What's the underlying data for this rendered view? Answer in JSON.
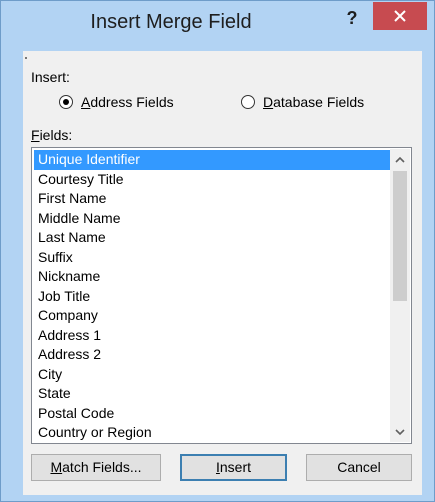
{
  "window": {
    "title": "Insert Merge Field",
    "help_label": "?",
    "close_label": "×"
  },
  "insert": {
    "label": "Insert:",
    "options": [
      {
        "label_mnemonic": "A",
        "label_rest": "ddress Fields",
        "checked": true
      },
      {
        "label_mnemonic": "D",
        "label_rest": "atabase Fields",
        "checked": false
      }
    ]
  },
  "fields": {
    "label_mnemonic": "F",
    "label_rest": "ields:",
    "selected_index": 0,
    "items": [
      "Unique Identifier",
      "Courtesy Title",
      "First Name",
      "Middle Name",
      "Last Name",
      "Suffix",
      "Nickname",
      "Job Title",
      "Company",
      "Address 1",
      "Address 2",
      "City",
      "State",
      "Postal Code",
      "Country or Region"
    ]
  },
  "buttons": {
    "match_fields": {
      "mnemonic": "M",
      "rest": "atch Fields..."
    },
    "insert": {
      "mnemonic": "I",
      "rest": "nsert"
    },
    "cancel": {
      "label": "Cancel"
    }
  },
  "colors": {
    "selection": "#3399ff",
    "close_button": "#c74b50",
    "frame": "#b2d3f3"
  },
  "icons": [
    "close-icon",
    "scroll-up-icon",
    "scroll-down-icon"
  ]
}
